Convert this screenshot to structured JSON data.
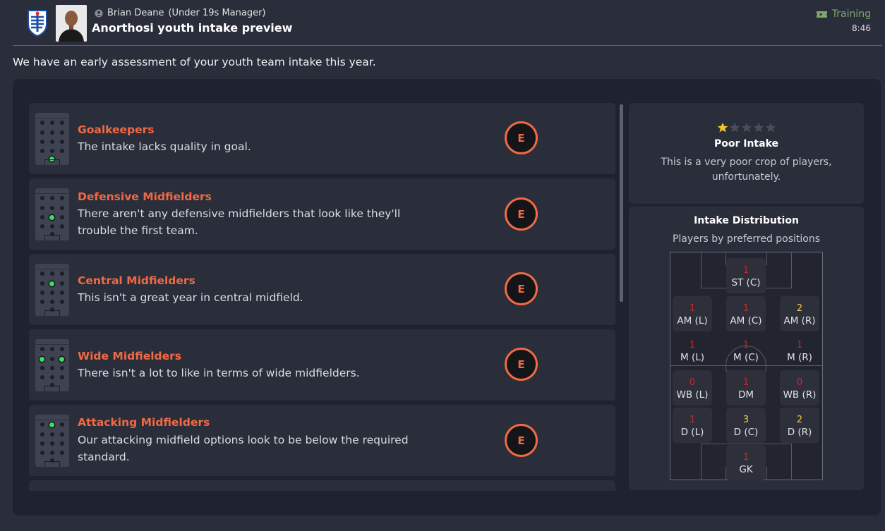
{
  "header": {
    "sender_name": "Brian Deane",
    "sender_role": "(Under 19s Manager)",
    "subject": "Anorthosi youth intake preview",
    "tag": "Training",
    "time": "8:46"
  },
  "intro": "We have an early assessment of your youth team intake this year.",
  "positions": [
    {
      "title": "Goalkeepers",
      "text": "The intake lacks quality in goal.",
      "grade": "E"
    },
    {
      "title": "Defensive Midfielders",
      "text": "There aren't any defensive midfielders that look like they'll trouble the first team.",
      "grade": "E"
    },
    {
      "title": "Central Midfielders",
      "text": "This isn't a great year in central midfield.",
      "grade": "E"
    },
    {
      "title": "Wide Midfielders",
      "text": "There isn't a lot to like in terms of wide midfielders.",
      "grade": "E"
    },
    {
      "title": "Attacking Midfielders",
      "text": "Our attacking midfield options look to be below the required standard.",
      "grade": "E"
    }
  ],
  "rating": {
    "stars": 1,
    "max_stars": 5,
    "title": "Poor Intake",
    "description": "This is a very poor crop of players, unfortunately."
  },
  "distribution": {
    "title": "Intake Distribution",
    "subtitle": "Players by preferred positions",
    "slots": [
      {
        "label": "ST (C)",
        "count": "1"
      },
      {
        "label": "AM (L)",
        "count": "1"
      },
      {
        "label": "AM (C)",
        "count": "1"
      },
      {
        "label": "AM (R)",
        "count": "2"
      },
      {
        "label": "M (L)",
        "count": "1"
      },
      {
        "label": "M (C)",
        "count": "1"
      },
      {
        "label": "M (R)",
        "count": "1"
      },
      {
        "label": "WB (L)",
        "count": "0"
      },
      {
        "label": "DM",
        "count": "1"
      },
      {
        "label": "WB (R)",
        "count": "0"
      },
      {
        "label": "D (L)",
        "count": "1"
      },
      {
        "label": "D (C)",
        "count": "3"
      },
      {
        "label": "D (R)",
        "count": "2"
      },
      {
        "label": "GK",
        "count": "1"
      }
    ]
  },
  "colors": {
    "accent_orange": "#f06a44",
    "count_low": "#c42a2a",
    "count_high": "#f2c84a",
    "star_filled": "#f2c230",
    "tag_green": "#7fa86a"
  }
}
